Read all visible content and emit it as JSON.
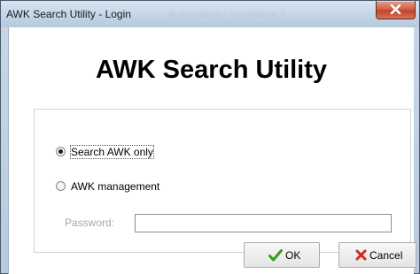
{
  "window": {
    "title": "AWK Search Utility - Login",
    "title_background_text": "Automation - Quotation T"
  },
  "heading": "AWK Search Utility",
  "options": [
    {
      "label": "Search AWK only",
      "selected": true
    },
    {
      "label": "AWK management",
      "selected": false
    }
  ],
  "password": {
    "label": "Password:",
    "value": ""
  },
  "buttons": {
    "ok": "OK",
    "cancel": "Cancel"
  },
  "colors": {
    "ok_icon": "#3c9a1e",
    "cancel_icon": "#d12b1b"
  }
}
